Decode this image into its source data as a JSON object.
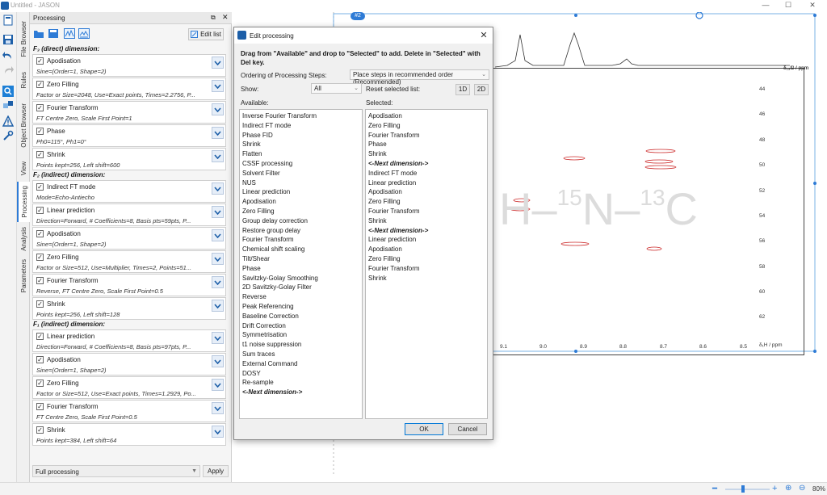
{
  "window": {
    "title": "Untitled - JASON",
    "minimize": "—",
    "maximize": "☐",
    "close": "✕"
  },
  "vtabs": [
    "File Browser",
    "Rules",
    "Object Browser",
    "View",
    "Processing",
    "Analysis",
    "Parameters"
  ],
  "panel": {
    "title": "Processing",
    "edit_list": "Edit list",
    "f3_header": "F₃ (direct) dimension:",
    "f2_header": "F₂ (indirect) dimension:",
    "f1_header": "F₁ (indirect) dimension:",
    "f3_steps": [
      {
        "name": "Apodisation",
        "params": "Sine=(Order=1, Shape=2)"
      },
      {
        "name": "Zero Filling",
        "params": "Factor or Size=2048, Use=Exact points, Times=2.2756, P..."
      },
      {
        "name": "Fourier Transform",
        "params": "FT Centre Zero, Scale First Point=1"
      },
      {
        "name": "Phase",
        "params": "Ph0=115°, Ph1=0°"
      },
      {
        "name": "Shrink",
        "params": "Points kept=256, Left shift=600"
      }
    ],
    "f2_steps": [
      {
        "name": "Indirect FT mode",
        "params": "Mode=Echo-Antiecho"
      },
      {
        "name": "Linear prediction",
        "params": "Direction=Forward, # Coefficients=8, Basis pts=59pts, P..."
      },
      {
        "name": "Apodisation",
        "params": "Sine=(Order=1, Shape=2)"
      },
      {
        "name": "Zero Filling",
        "params": "Factor or Size=512, Use=Multiplier, Times=2, Points=51..."
      },
      {
        "name": "Fourier Transform",
        "params": "Reverse, FT Centre Zero, Scale First Point=0.5"
      },
      {
        "name": "Shrink",
        "params": "Points kept=256, Left shift=128"
      }
    ],
    "f1_steps": [
      {
        "name": "Linear prediction",
        "params": "Direction=Forward, # Coefficients=8, Basis pts=97pts, P..."
      },
      {
        "name": "Apodisation",
        "params": "Sine=(Order=1, Shape=2)"
      },
      {
        "name": "Zero Filling",
        "params": "Factor or Size=512, Use=Exact points, Times=1.2929, Po..."
      },
      {
        "name": "Fourier Transform",
        "params": "FT Centre Zero, Scale First Point=0.5"
      },
      {
        "name": "Shrink",
        "params": "Points kept=384, Left shift=64"
      }
    ],
    "preset": "Full processing",
    "apply": "Apply"
  },
  "spectrum": {
    "tag": "#2",
    "watermark_h": "H",
    "watermark_n_mass": "15",
    "watermark_n": "N",
    "watermark_c_mass": "13",
    "watermark_c": "C",
    "y_axis_label": "δ₁₅N / ppm",
    "y_ticks": [
      "44",
      "46",
      "48",
      "50",
      "52",
      "54",
      "56",
      "58",
      "60",
      "62"
    ],
    "x_axis_label": "δ₁H / ppm",
    "x_ticks": [
      "9.1",
      "9.0",
      "8.9",
      "8.8",
      "8.7",
      "8.6",
      "8.5"
    ],
    "top_axis_label": "δ₁₃C / ppm"
  },
  "status": {
    "zoom": "80%"
  },
  "dialog": {
    "title": "Edit processing",
    "instructions": "Drag from \"Available\" and drop to \"Selected\" to add. Delete in \"Selected\" with Del key.",
    "ordering_label": "Ordering of Processing Steps:",
    "ordering_value": "Place steps in recommended order (Recommended)",
    "show_label": "Show:",
    "show_value": "All",
    "reset_label": "Reset selected list:",
    "btn_1d": "1D",
    "btn_2d": "2D",
    "available_label": "Available:",
    "selected_label": "Selected:",
    "available": [
      "Inverse Fourier Transform",
      "Indirect FT mode",
      "Phase FID",
      "Shrink",
      "Flatten",
      "CSSF processing",
      "Solvent Filter",
      "NUS",
      "Linear prediction",
      "Apodisation",
      "Zero Filling",
      "Group delay correction",
      "Restore group delay",
      "Fourier Transform",
      "Chemical shift scaling",
      "Tilt/Shear",
      "Phase",
      "Savitzky-Golay Smoothing",
      "2D Savitzky-Golay Filter",
      "Reverse",
      "Peak Referencing",
      "Baseline Correction",
      "Drift Correction",
      "Symmetrisation",
      "t1 noise suppression",
      "Sum traces",
      "External Command",
      "DOSY",
      "Re-sample",
      "<-Next dimension->"
    ],
    "selected": [
      "Apodisation",
      "Zero Filling",
      "Fourier Transform",
      "Phase",
      "Shrink",
      "<-Next dimension->",
      "Indirect FT mode",
      "Linear prediction",
      "Apodisation",
      "Zero Filling",
      "Fourier Transform",
      "Shrink",
      "<-Next dimension->",
      "Linear prediction",
      "Apodisation",
      "Zero Filling",
      "Fourier Transform",
      "Shrink"
    ],
    "ok": "OK",
    "cancel": "Cancel"
  }
}
